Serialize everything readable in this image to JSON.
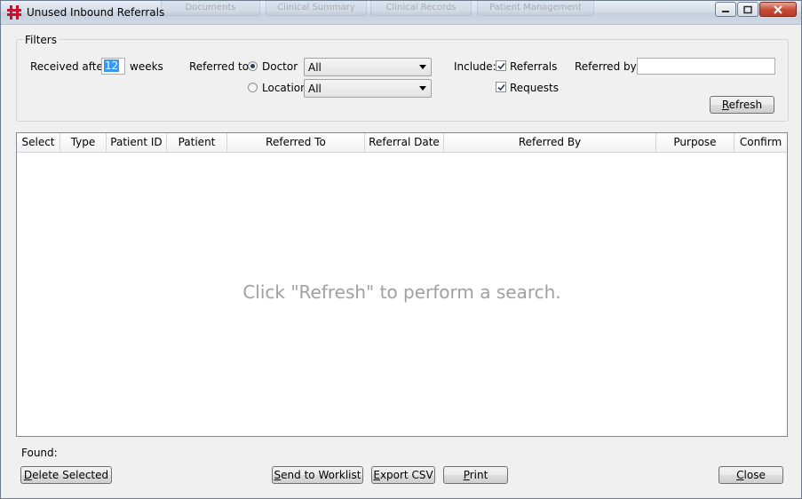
{
  "window": {
    "title": "Unused Inbound Referrals",
    "background_tabs": [
      "Documents",
      "Clinical Summary",
      "Clinical Records",
      "Patient Management"
    ]
  },
  "filters": {
    "group_label": "Filters",
    "received_after_label": "Received after:",
    "received_after_value": "12",
    "weeks_label": "weeks",
    "referred_to_label": "Referred to:",
    "doctor_label": "Doctor",
    "doctor_selected": true,
    "doctor_combo_value": "All",
    "location_label": "Location",
    "location_selected": false,
    "location_combo_value": "All",
    "include_label": "Include:",
    "referrals_label": "Referrals",
    "referrals_checked": true,
    "requests_label": "Requests",
    "requests_checked": true,
    "referred_by_label": "Referred by:",
    "referred_by_value": "",
    "refresh_button": {
      "mnemonic": "R",
      "rest": "efresh"
    }
  },
  "grid": {
    "columns": [
      "Select",
      "Type",
      "Patient ID",
      "Patient",
      "Referred To",
      "Referral Date",
      "Referred By",
      "Purpose",
      "Confirm"
    ],
    "rows": [],
    "empty_message": "Click \"Refresh\" to perform a search."
  },
  "footer": {
    "found_label": "Found:",
    "delete_button": {
      "mnemonic": "D",
      "rest": "elete Selected"
    },
    "send_button": {
      "mnemonic": "S",
      "rest": "end to Worklist"
    },
    "export_button": {
      "mnemonic": "E",
      "rest": "xport CSV"
    },
    "print_button": {
      "mnemonic": "P",
      "rest": "rint"
    },
    "close_button": {
      "mnemonic": "C",
      "rest": "lose"
    }
  },
  "colors": {
    "accent": "#3399ff",
    "app_icon": "#c4122f",
    "empty_text": "#a0a0a0"
  }
}
